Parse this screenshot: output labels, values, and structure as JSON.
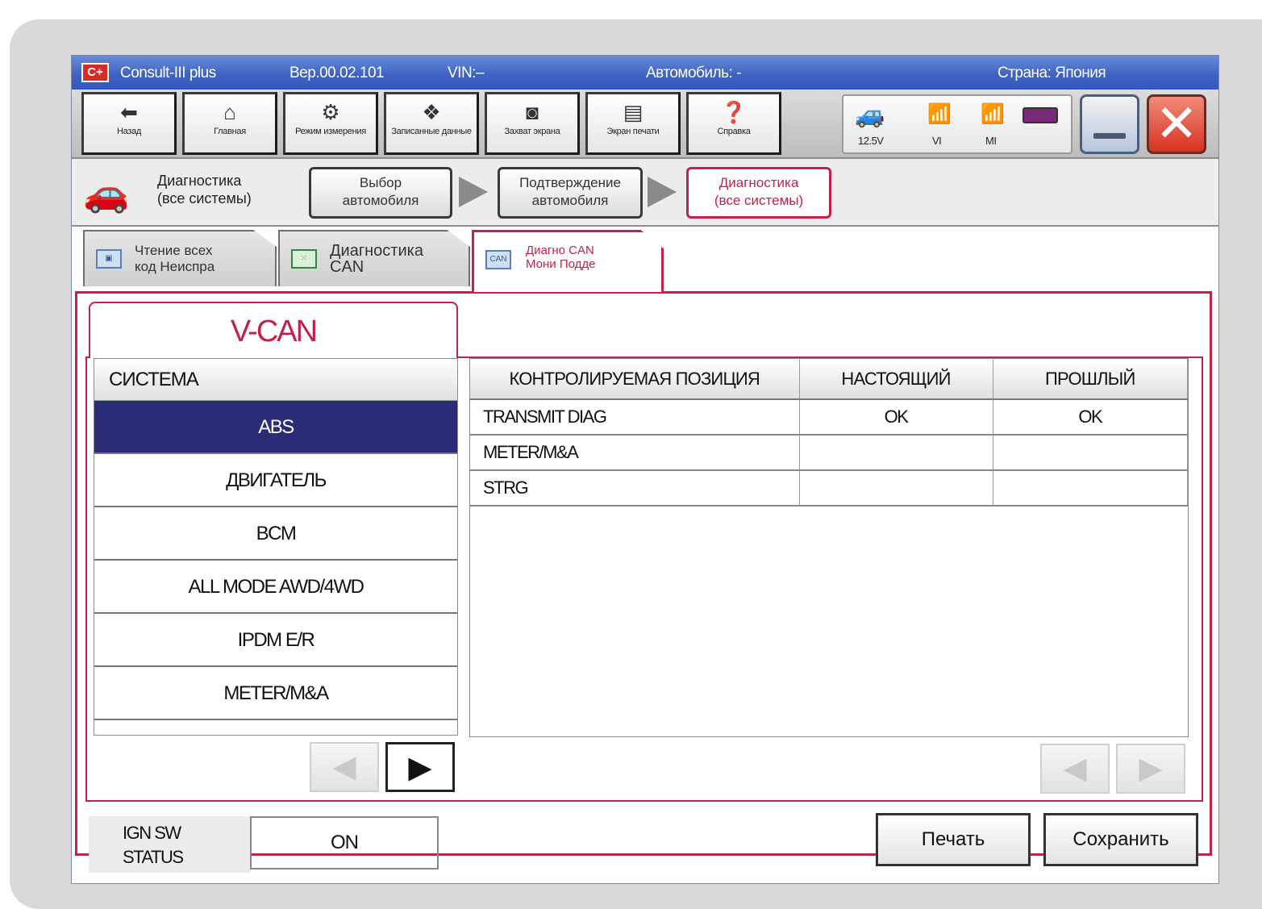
{
  "titlebar": {
    "logo": "C+",
    "app_name": "Consult-III plus",
    "version": "Вер.00.02.101",
    "vin": "VIN:–",
    "vehicle": "Автомобиль: -",
    "country": "Страна: Япония"
  },
  "toolbar": {
    "buttons": [
      {
        "label": "Назад",
        "icon": "back-arrow-icon"
      },
      {
        "label": "Главная",
        "icon": "home-icon"
      },
      {
        "label": "Режим измерения",
        "icon": "measurement-icon"
      },
      {
        "label": "Записанные данные",
        "icon": "recorded-data-icon"
      },
      {
        "label": "Захват экрана",
        "icon": "camera-icon"
      },
      {
        "label": "Экран печати",
        "icon": "printer-icon"
      },
      {
        "label": "Справка",
        "icon": "help-icon"
      }
    ],
    "status": {
      "voltage": "12.5V",
      "vi": "VI",
      "mi": "MI"
    }
  },
  "breadcrumb": {
    "title_line1": "Диагностика",
    "title_line2": "(все системы)",
    "steps": [
      {
        "line1": "Выбор",
        "line2": "автомобиля"
      },
      {
        "line1": "Подтверждение",
        "line2": "автомобиля"
      },
      {
        "line1": "Диагностика",
        "line2": "(все системы)"
      }
    ]
  },
  "tabs": [
    {
      "line1": "Чтение всех",
      "line2": "код Неиспра"
    },
    {
      "line1": "Диагностика",
      "line2": "CAN"
    },
    {
      "line1": "Диагно CAN",
      "line2": "Мони Подде"
    }
  ],
  "panel": {
    "title": "V-CAN",
    "system_header": "СИСТЕМА",
    "systems": [
      "ABS",
      "ДВИГАТЕЛЬ",
      "BCM",
      "ALL MODE AWD/4WD",
      "IPDM E/R",
      "METER/M&A"
    ],
    "selected_system": "ABS",
    "columns": [
      "КОНТРОЛИРУЕМАЯ ПОЗИЦИЯ",
      "НАСТОЯЩИЙ",
      "ПРОШЛЫЙ"
    ],
    "rows": [
      {
        "item": "TRANSMIT DIAG",
        "present": "OK",
        "past": "OK"
      },
      {
        "item": "METER/M&A",
        "present": "",
        "past": ""
      },
      {
        "item": "STRG",
        "present": "",
        "past": ""
      }
    ]
  },
  "footer": {
    "ign_label_line1": "IGN SW",
    "ign_label_line2": "STATUS",
    "ign_value": "ON",
    "print_label": "Печать",
    "save_label": "Сохранить"
  },
  "colors": {
    "accent": "#c2224a",
    "selected_row": "#2a2d76",
    "titlebar": "#3f63c4"
  }
}
